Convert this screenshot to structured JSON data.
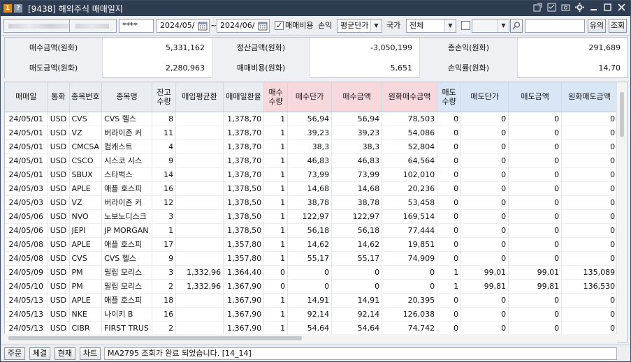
{
  "window": {
    "badge1": "1",
    "badge2": "?",
    "title": "[9438] 해외주식 매매일지"
  },
  "toolbar": {
    "account_masked": "",
    "account_name_masked": "",
    "password": "****",
    "date_from": "2024/05/",
    "date_sep": "~",
    "date_to": "2024/06/",
    "fee_label": "매매비용",
    "pnl_label": "손익",
    "pnl_method": "평균단가",
    "country_label": "국가",
    "country_value": "전체",
    "notice_btn": "유의",
    "query_btn": "조회"
  },
  "summary": {
    "buy_amt_label": "매수금액(원화)",
    "buy_amt": "5,331,162",
    "settle_label": "정산금액(원화)",
    "settle": "-3,050,199",
    "total_pnl_label": "총손익(원화)",
    "total_pnl": "291,689",
    "sell_amt_label": "매도금액(원화)",
    "sell_amt": "2,280,963",
    "fee_label": "매매비용(원화)",
    "fee": "5,651",
    "pnl_rate_label": "손익률(원화)",
    "pnl_rate": "14,70"
  },
  "columns": [
    "매매일",
    "통화",
    "종목번호",
    "종목명",
    "잔고\n수량",
    "매입평균환",
    "매매일환율",
    "매수\n수량",
    "매수단가",
    "매수금액",
    "원화매수금액",
    "매도\n수량",
    "매도단가",
    "매도금액",
    "원화매도금액"
  ],
  "rows": [
    [
      "24/05/01",
      "USD",
      "CVS",
      "CVS 헬스",
      "8",
      "",
      "1,378,70",
      "1",
      "56,94",
      "56,94",
      "78,503",
      "0",
      "0",
      "0",
      "0"
    ],
    [
      "24/05/01",
      "USD",
      "VZ",
      "버라이존 커",
      "11",
      "",
      "1,378,70",
      "1",
      "39,23",
      "39,23",
      "54,086",
      "0",
      "0",
      "0",
      "0"
    ],
    [
      "24/05/01",
      "USD",
      "CMCSA",
      "컴캐스트",
      "4",
      "",
      "1,378,70",
      "1",
      "38,3",
      "38,3",
      "52,804",
      "0",
      "0",
      "0",
      "0"
    ],
    [
      "24/05/01",
      "USD",
      "CSCO",
      "시스코 시스",
      "9",
      "",
      "1,378,70",
      "1",
      "46,83",
      "46,83",
      "64,564",
      "0",
      "0",
      "0",
      "0"
    ],
    [
      "24/05/01",
      "USD",
      "SBUX",
      "스타벅스",
      "14",
      "",
      "1,378,70",
      "1",
      "73,99",
      "73,99",
      "102,010",
      "0",
      "0",
      "0",
      "0"
    ],
    [
      "24/05/03",
      "USD",
      "APLE",
      "애플 호스피",
      "16",
      "",
      "1,378,50",
      "1",
      "14,68",
      "14,68",
      "20,236",
      "0",
      "0",
      "0",
      "0"
    ],
    [
      "24/05/03",
      "USD",
      "VZ",
      "버라이존 커",
      "12",
      "",
      "1,378,50",
      "1",
      "38,78",
      "38,78",
      "53,458",
      "0",
      "0",
      "0",
      "0"
    ],
    [
      "24/05/06",
      "USD",
      "NVO",
      "노보노디스크",
      "3",
      "",
      "1,378,50",
      "1",
      "122,97",
      "122,97",
      "169,514",
      "0",
      "0",
      "0",
      "0"
    ],
    [
      "24/05/06",
      "USD",
      "JEPI",
      "JP MORGAN",
      "1",
      "",
      "1,378,50",
      "1",
      "56,18",
      "56,18",
      "77,444",
      "0",
      "0",
      "0",
      "0"
    ],
    [
      "24/05/08",
      "USD",
      "APLE",
      "애플 호스피",
      "17",
      "",
      "1,357,80",
      "1",
      "14,62",
      "14,62",
      "19,851",
      "0",
      "0",
      "0",
      "0"
    ],
    [
      "24/05/08",
      "USD",
      "CVS",
      "CVS 헬스",
      "9",
      "",
      "1,357,80",
      "1",
      "55,17",
      "55,17",
      "74,909",
      "0",
      "0",
      "0",
      "0"
    ],
    [
      "24/05/09",
      "USD",
      "PM",
      "필립 모리스",
      "3",
      "1,332,96",
      "1,364,40",
      "0",
      "0",
      "0",
      "0",
      "1",
      "99,01",
      "99,01",
      "135,089"
    ],
    [
      "24/05/10",
      "USD",
      "PM",
      "필립 모리스",
      "2",
      "1,332,96",
      "1,367,90",
      "0",
      "0",
      "0",
      "0",
      "1",
      "99,81",
      "99,81",
      "136,530"
    ],
    [
      "24/05/13",
      "USD",
      "APLE",
      "애플 호스피",
      "18",
      "",
      "1,367,90",
      "1",
      "14,91",
      "14,91",
      "20,395",
      "0",
      "0",
      "0",
      "0"
    ],
    [
      "24/05/13",
      "USD",
      "NKE",
      "나이키 B",
      "16",
      "",
      "1,367,90",
      "1",
      "92,14",
      "92,14",
      "126,038",
      "0",
      "0",
      "0",
      "0"
    ],
    [
      "24/05/13",
      "USD",
      "CIBR",
      "FIRST TRUS",
      "2",
      "",
      "1,367,90",
      "1",
      "54,64",
      "54,64",
      "74,742",
      "0",
      "0",
      "0",
      "0"
    ]
  ],
  "statusbar": {
    "order_btn": "주문",
    "fill_btn": "체결",
    "current_btn": "현재",
    "chart_btn": "차트",
    "message": "MA2795 조회가 완료 되었습니다. [14_14]"
  }
}
